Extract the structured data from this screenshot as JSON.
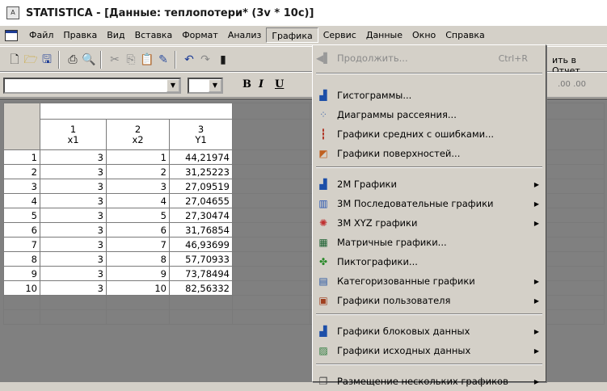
{
  "window": {
    "icon_label": "A",
    "title": "STATISTICA - [Данные: теплопотери* (3v * 10c)]"
  },
  "menubar": {
    "items": [
      "Файл",
      "Правка",
      "Вид",
      "Вставка",
      "Формат",
      "Анализ",
      "Графика",
      "Сервис",
      "Данные",
      "Окно",
      "Справка"
    ],
    "active": "Графика"
  },
  "toolbar": {
    "right_text": "ить в Отчет",
    "bold_label": "B",
    "italic_label": "I",
    "underline_label": "U",
    "decimal_icons": ".00 .00"
  },
  "spreadsheet": {
    "columns": [
      {
        "number": "1",
        "name": "x1"
      },
      {
        "number": "2",
        "name": "x2"
      },
      {
        "number": "3",
        "name": "Y1"
      }
    ],
    "rows": [
      {
        "n": "1",
        "x1": "3",
        "x2": "1",
        "y1": "44,21974"
      },
      {
        "n": "2",
        "x1": "3",
        "x2": "2",
        "y1": "31,25223"
      },
      {
        "n": "3",
        "x1": "3",
        "x2": "3",
        "y1": "27,09519"
      },
      {
        "n": "4",
        "x1": "3",
        "x2": "4",
        "y1": "27,04655"
      },
      {
        "n": "5",
        "x1": "3",
        "x2": "5",
        "y1": "27,30474"
      },
      {
        "n": "6",
        "x1": "3",
        "x2": "6",
        "y1": "31,76854"
      },
      {
        "n": "7",
        "x1": "3",
        "x2": "7",
        "y1": "46,93699"
      },
      {
        "n": "8",
        "x1": "3",
        "x2": "8",
        "y1": "57,70933"
      },
      {
        "n": "9",
        "x1": "3",
        "x2": "9",
        "y1": "73,78494"
      },
      {
        "n": "10",
        "x1": "3",
        "x2": "10",
        "y1": "82,56332"
      }
    ]
  },
  "graphics_menu": {
    "continue": {
      "label": "Продолжить...",
      "shortcut": "Ctrl+R"
    },
    "items": [
      {
        "label": "Гистограммы...",
        "icon": "histogram-icon",
        "submenu": false
      },
      {
        "label": "Диаграммы рассеяния...",
        "icon": "scatter-icon",
        "submenu": false
      },
      {
        "label": "Графики средних с ошибками...",
        "icon": "means-icon",
        "submenu": false
      },
      {
        "label": "Графики поверхностей...",
        "icon": "surface-icon",
        "submenu": false
      },
      {
        "label": "2М Графики",
        "icon": "2d-graph-icon",
        "submenu": true
      },
      {
        "label": "3М Последовательные графики",
        "icon": "3d-sequential-icon",
        "submenu": true
      },
      {
        "label": "3М XYZ графики",
        "icon": "3d-xyz-icon",
        "submenu": true
      },
      {
        "label": "Матричные графики...",
        "icon": "matrix-icon",
        "submenu": false
      },
      {
        "label": "Пиктографики...",
        "icon": "icon-plot-icon",
        "submenu": false
      },
      {
        "label": "Категоризованные графики",
        "icon": "categorized-icon",
        "submenu": true
      },
      {
        "label": "Графики пользователя",
        "icon": "user-graph-icon",
        "submenu": true
      },
      {
        "label": "Графики блоковых данных",
        "icon": "block-data-icon",
        "submenu": true
      },
      {
        "label": "Графики исходных данных",
        "icon": "input-data-icon",
        "submenu": true
      },
      {
        "label": "Размещение нескольких графиков",
        "icon": "multi-graph-icon",
        "submenu": true
      }
    ]
  }
}
